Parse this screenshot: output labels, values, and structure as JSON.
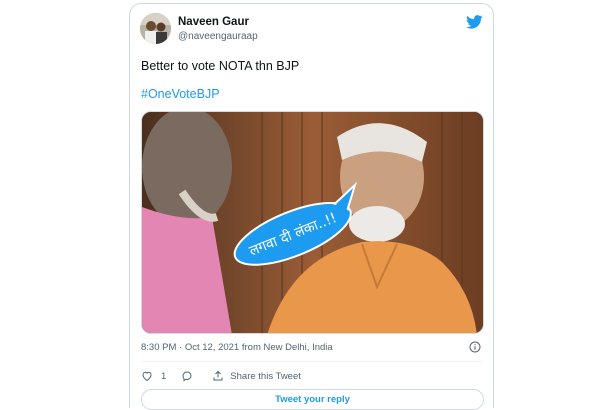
{
  "author": {
    "display_name": "Naveen Gaur",
    "handle": "@naveengauraap"
  },
  "tweet": {
    "text": "Better to vote NOTA thn BJP",
    "hashtag": "#OneVoteBJP"
  },
  "media": {
    "speech_bubble_text": "लगवा दी लंका..!!"
  },
  "meta": {
    "time_and_place": "8:30 PM · Oct 12, 2021 from New Delhi, India"
  },
  "actions": {
    "like_count": "1",
    "share_label": "Share this Tweet",
    "reply_button_label": "Tweet your reply"
  },
  "icons": {
    "brand": "twitter-bird-icon",
    "like": "heart-icon",
    "reply": "speech-bubble-icon",
    "share": "share-arrow-icon",
    "info": "info-icon"
  },
  "colors": {
    "accent": "#1d9bf0",
    "secondary_text": "#536471",
    "border": "#cfd9de"
  }
}
